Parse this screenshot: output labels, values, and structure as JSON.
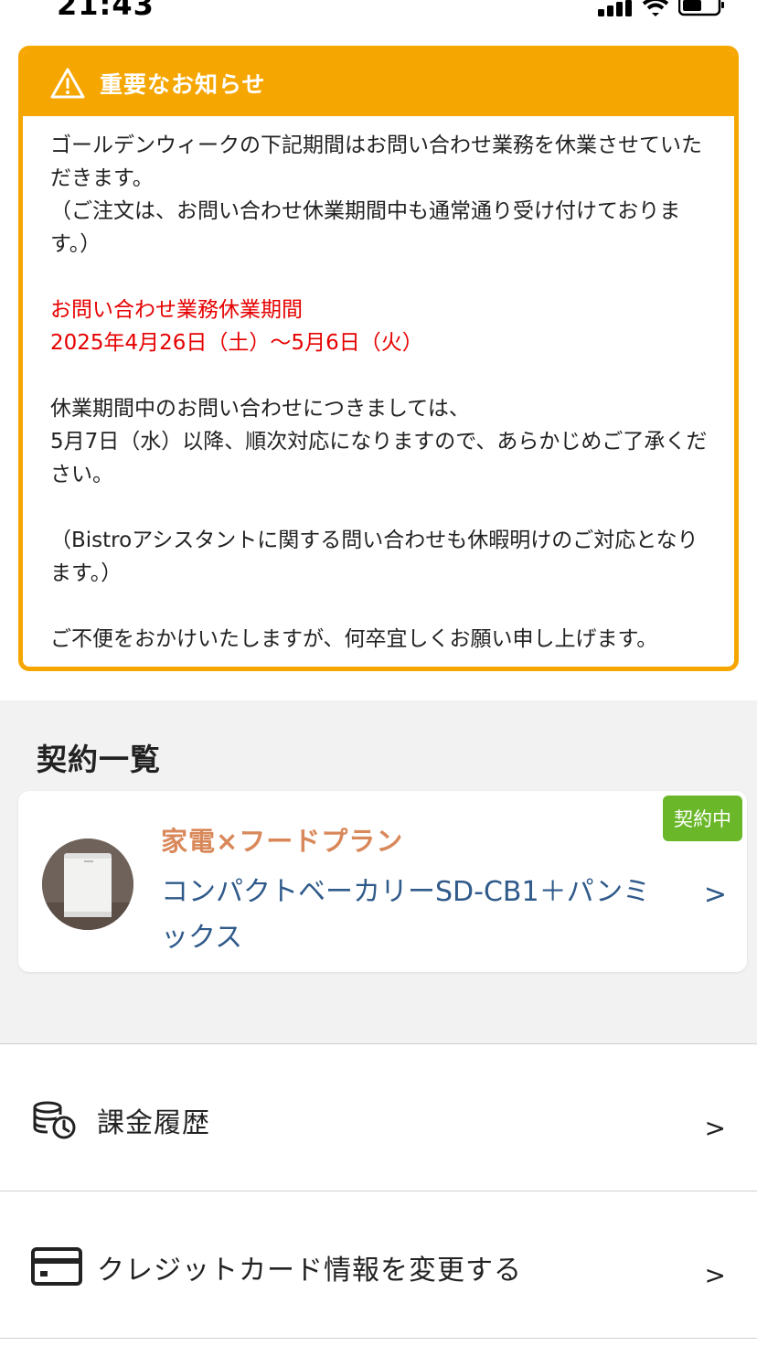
{
  "status_bar": {
    "time": "21:43"
  },
  "notice": {
    "title": "重要なお知らせ",
    "icon": "warning-icon",
    "paragraph1": "ゴールデンウィークの下記期間はお問い合わせ業務を休業させていただきます。\n（ご注文は、お問い合わせ休業期間中も通常通り受け付けております。）",
    "closure_label": "お問い合わせ業務休業期間",
    "closure_dates": "2025年4月26日（土）〜5月6日（火）",
    "paragraph2": "休業期間中のお問い合わせにつきましては、\n5月7日（水）以降、順次対応になりますので、あらかじめご了承ください。",
    "paragraph3": "（Bistroアシスタントに関する問い合わせも休暇明けのご対応となります。）",
    "paragraph4": "ご不便をおかけいたしますが、何卒宜しくお願い申し上げます。",
    "accent_color": "#f6a600",
    "alert_color": "#e60000"
  },
  "contracts": {
    "section_title": "契約一覧",
    "items": [
      {
        "status_badge": "契約中",
        "plan": "家電×フードプラン",
        "product": "コンパクトベーカリーSD-CB1＋パンミックス",
        "chevron": ">"
      }
    ]
  },
  "menu": {
    "items": [
      {
        "label": "課金履歴",
        "icon": "billing-history-icon",
        "chevron": ">"
      },
      {
        "label": "クレジットカード情報を変更する",
        "icon": "credit-card-icon",
        "chevron": ">"
      }
    ]
  }
}
